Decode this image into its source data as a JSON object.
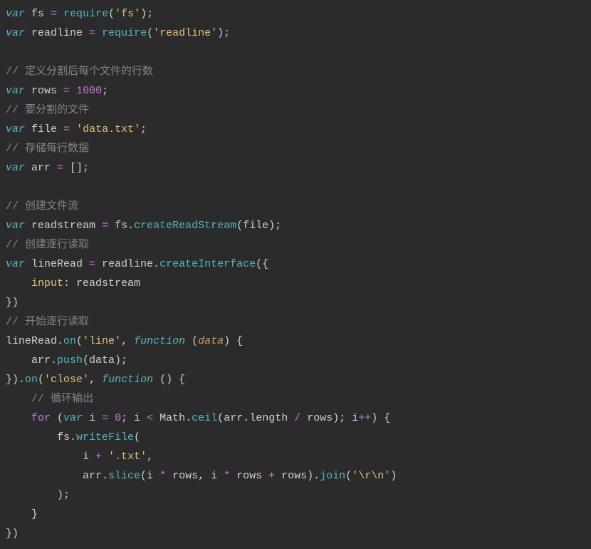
{
  "code": {
    "tokens": [
      [
        [
          "kw",
          "var"
        ],
        [
          "id",
          " fs "
        ],
        [
          "op",
          "="
        ],
        [
          "id",
          " "
        ],
        [
          "fn",
          "require"
        ],
        [
          "id",
          "("
        ],
        [
          "str",
          "'fs'"
        ],
        [
          "id",
          ");"
        ]
      ],
      [
        [
          "kw",
          "var"
        ],
        [
          "id",
          " readline "
        ],
        [
          "op",
          "="
        ],
        [
          "id",
          " "
        ],
        [
          "fn",
          "require"
        ],
        [
          "id",
          "("
        ],
        [
          "str",
          "'readline'"
        ],
        [
          "id",
          ");"
        ]
      ],
      [],
      [
        [
          "cmt",
          "// 定义分割后每个文件的行数"
        ]
      ],
      [
        [
          "kw",
          "var"
        ],
        [
          "id",
          " rows "
        ],
        [
          "op",
          "="
        ],
        [
          "id",
          " "
        ],
        [
          "num",
          "1000"
        ],
        [
          "id",
          ";"
        ]
      ],
      [
        [
          "cmt",
          "// 要分割的文件"
        ]
      ],
      [
        [
          "kw",
          "var"
        ],
        [
          "id",
          " file "
        ],
        [
          "op",
          "="
        ],
        [
          "id",
          " "
        ],
        [
          "str",
          "'data.txt'"
        ],
        [
          "id",
          ";"
        ]
      ],
      [
        [
          "cmt",
          "// 存储每行数据"
        ]
      ],
      [
        [
          "kw",
          "var"
        ],
        [
          "id",
          " arr "
        ],
        [
          "op",
          "="
        ],
        [
          "id",
          " [];"
        ]
      ],
      [],
      [
        [
          "cmt",
          "// 创建文件流"
        ]
      ],
      [
        [
          "kw",
          "var"
        ],
        [
          "id",
          " readstream "
        ],
        [
          "op",
          "="
        ],
        [
          "id",
          " fs."
        ],
        [
          "fn",
          "createReadStream"
        ],
        [
          "id",
          "(file);"
        ]
      ],
      [
        [
          "cmt",
          "// 创建逐行读取"
        ]
      ],
      [
        [
          "kw",
          "var"
        ],
        [
          "id",
          " lineRead "
        ],
        [
          "op",
          "="
        ],
        [
          "id",
          " readline."
        ],
        [
          "fn",
          "createInterface"
        ],
        [
          "id",
          "({"
        ]
      ],
      [
        [
          "id",
          "    "
        ],
        [
          "prop",
          "input"
        ],
        [
          "id",
          ": readstream"
        ]
      ],
      [
        [
          "id",
          "})"
        ]
      ],
      [
        [
          "cmt",
          "// 开始逐行读取"
        ]
      ],
      [
        [
          "id",
          "lineRead."
        ],
        [
          "fn",
          "on"
        ],
        [
          "id",
          "("
        ],
        [
          "str",
          "'line'"
        ],
        [
          "id",
          ", "
        ],
        [
          "fkw",
          "function"
        ],
        [
          "id",
          " ("
        ],
        [
          "prm",
          "data"
        ],
        [
          "id",
          ") {"
        ]
      ],
      [
        [
          "id",
          "    arr."
        ],
        [
          "fn",
          "push"
        ],
        [
          "id",
          "(data);"
        ]
      ],
      [
        [
          "id",
          "})."
        ],
        [
          "fn",
          "on"
        ],
        [
          "id",
          "("
        ],
        [
          "str",
          "'close'"
        ],
        [
          "id",
          ", "
        ],
        [
          "fkw",
          "function"
        ],
        [
          "id",
          " () {"
        ]
      ],
      [
        [
          "id",
          "    "
        ],
        [
          "cmt",
          "// 循环输出"
        ]
      ],
      [
        [
          "id",
          "    "
        ],
        [
          "ctrl",
          "for"
        ],
        [
          "id",
          " ("
        ],
        [
          "kw",
          "var"
        ],
        [
          "id",
          " i "
        ],
        [
          "op",
          "="
        ],
        [
          "id",
          " "
        ],
        [
          "num",
          "0"
        ],
        [
          "id",
          "; i "
        ],
        [
          "op",
          "<"
        ],
        [
          "id",
          " Math."
        ],
        [
          "fn",
          "ceil"
        ],
        [
          "id",
          "(arr.length "
        ],
        [
          "op",
          "/"
        ],
        [
          "id",
          " rows); i"
        ],
        [
          "op",
          "++"
        ],
        [
          "id",
          ") {"
        ]
      ],
      [
        [
          "id",
          "        fs."
        ],
        [
          "fn",
          "writeFile"
        ],
        [
          "id",
          "("
        ]
      ],
      [
        [
          "id",
          "            i "
        ],
        [
          "op",
          "+"
        ],
        [
          "id",
          " "
        ],
        [
          "str",
          "'.txt'"
        ],
        [
          "id",
          ","
        ]
      ],
      [
        [
          "id",
          "            arr."
        ],
        [
          "fn",
          "slice"
        ],
        [
          "id",
          "(i "
        ],
        [
          "op",
          "*"
        ],
        [
          "id",
          " rows, i "
        ],
        [
          "op",
          "*"
        ],
        [
          "id",
          " rows "
        ],
        [
          "op",
          "+"
        ],
        [
          "id",
          " rows)."
        ],
        [
          "fn",
          "join"
        ],
        [
          "id",
          "("
        ],
        [
          "str",
          "'\\r\\n'"
        ],
        [
          "id",
          ")"
        ]
      ],
      [
        [
          "id",
          "        );"
        ]
      ],
      [
        [
          "id",
          "    }"
        ]
      ],
      [
        [
          "id",
          "})"
        ]
      ]
    ]
  }
}
